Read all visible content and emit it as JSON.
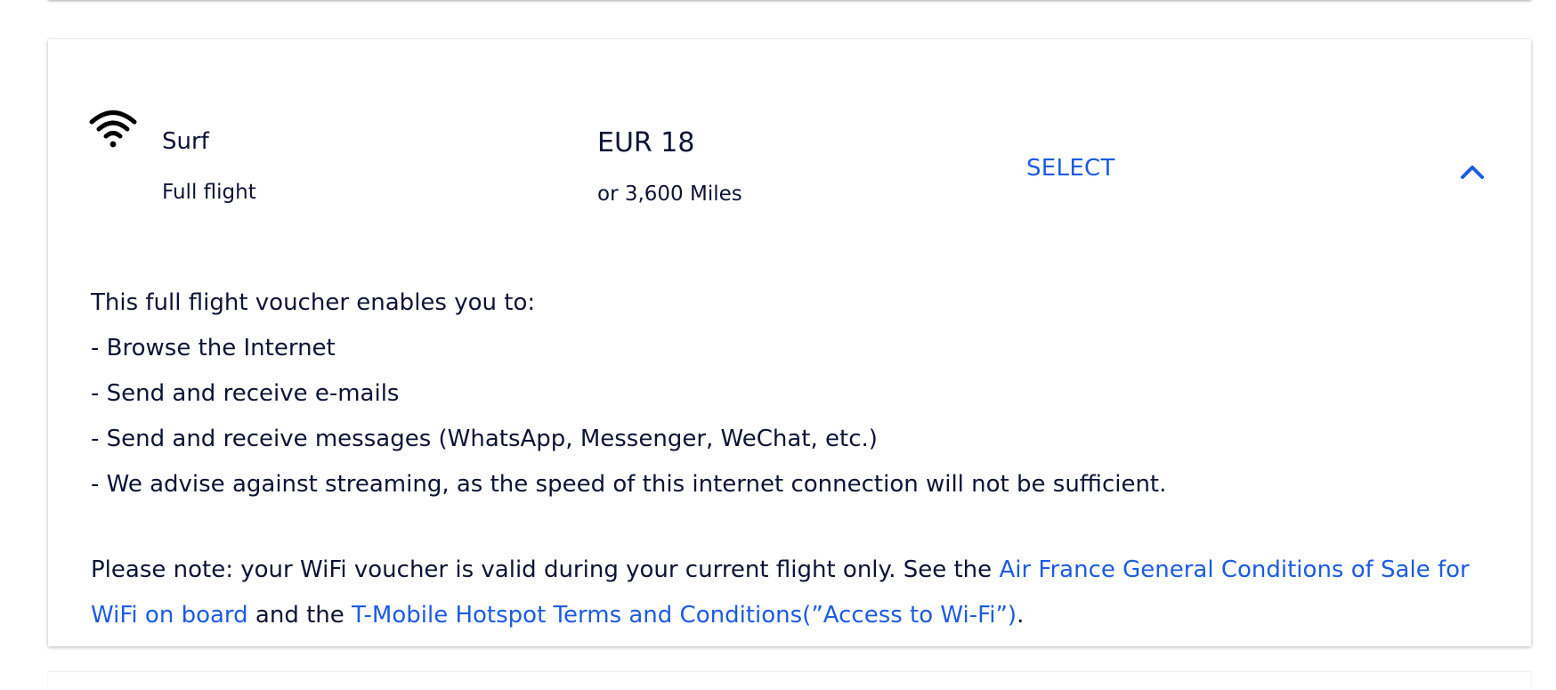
{
  "offer": {
    "name": "Surf",
    "duration": "Full flight",
    "price": "EUR 18",
    "price_miles": "or 3,600 Miles",
    "select_label": "SELECT",
    "icon": "wifi-icon",
    "accent_color": "#1d5be0",
    "expanded": true
  },
  "details": {
    "intro": "This full flight voucher enables you to:",
    "items": [
      "- Browse the Internet",
      "- Send and receive e-mails",
      "- Send and receive messages (WhatsApp, Messenger, WeChat, etc.)",
      "- We advise against streaming, as the speed of this internet connection will not be sufficient."
    ],
    "note_prefix": "Please note: your WiFi voucher is valid during your current flight only. See the ",
    "link1": "Air France General Conditions of Sale for WiFi on board",
    "note_middle": " and the ",
    "link2": "T-Mobile Hotspot Terms and Conditions(”Access to Wi-Fi”)",
    "note_suffix": "."
  }
}
